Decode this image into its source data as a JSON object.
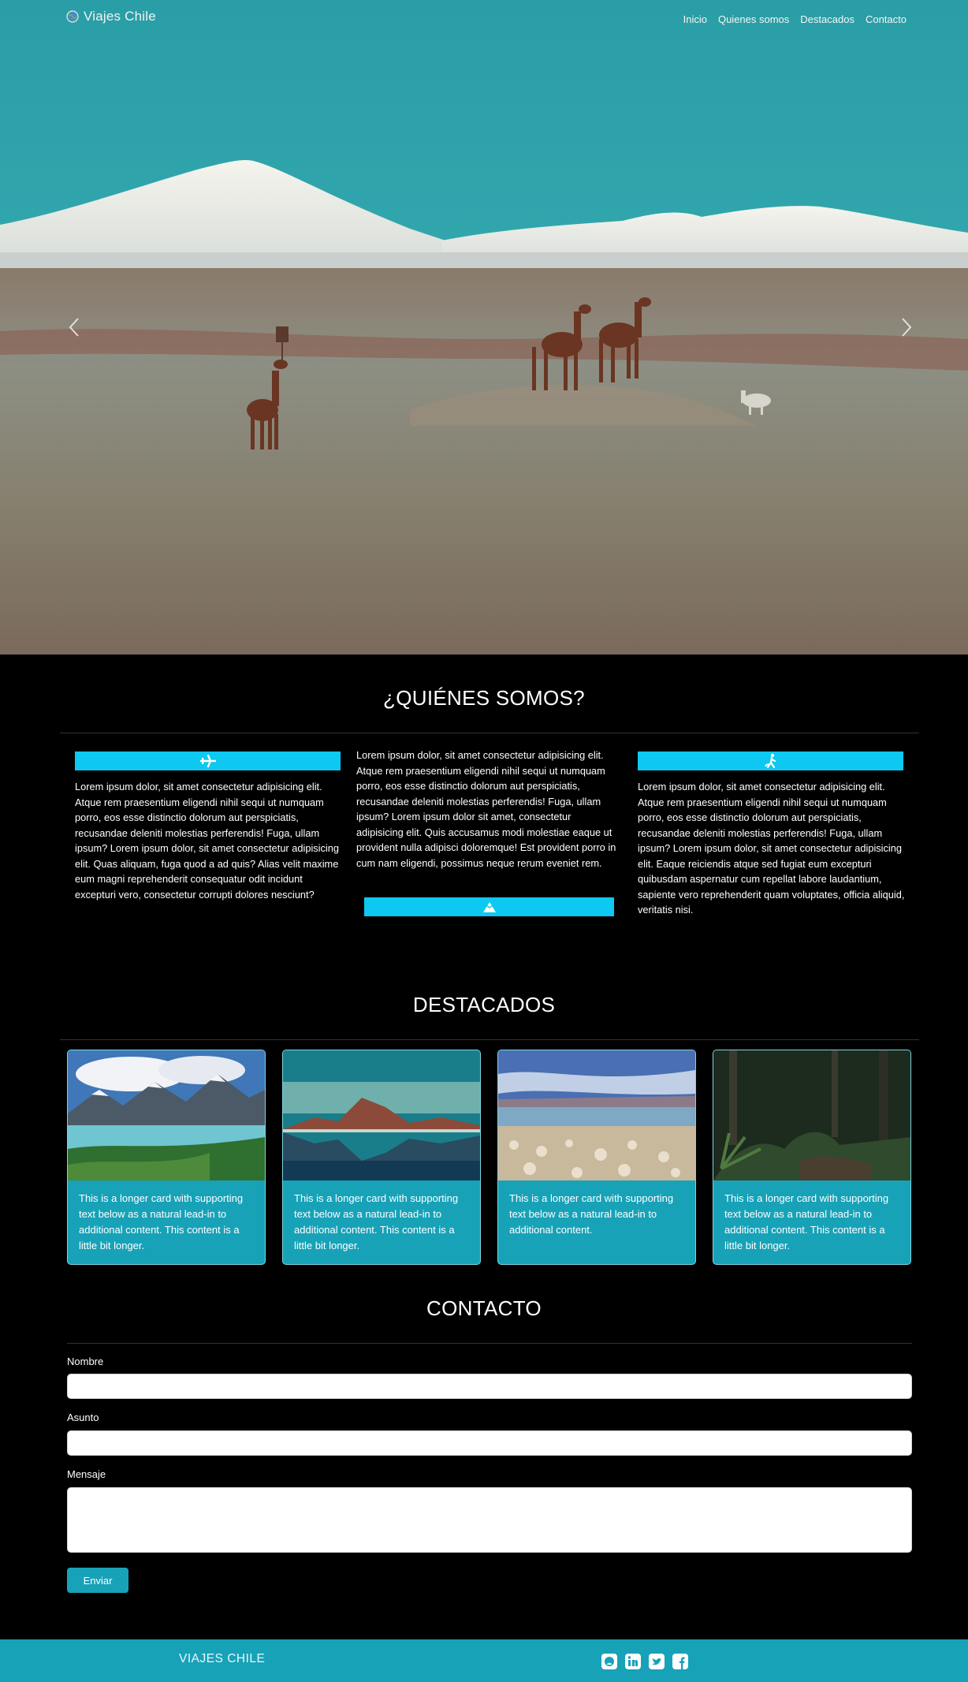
{
  "navbar": {
    "brand": "Viajes Chile",
    "links": [
      "Inicio",
      "Quienes somos",
      "Destacados",
      "Contacto"
    ]
  },
  "about": {
    "title": "¿QUIÉNES SOMOS?",
    "columns": [
      {
        "icon": "airplane-icon",
        "text": "Lorem ipsum dolor, sit amet consectetur adipisicing elit. Atque rem praesentium eligendi nihil sequi ut numquam porro, eos esse distinctio dolorum aut perspiciatis, recusandae deleniti molestias perferendis! Fuga, ullam ipsum? Lorem ipsum dolor, sit amet consectetur adipisicing elit. Quas aliquam, fuga quod a ad quis? Alias velit maxime eum magni reprehenderit consequatur odit incidunt excepturi vero, consectetur corrupti dolores nesciunt?"
      },
      {
        "icon": "mountain-icon",
        "text": "Lorem ipsum dolor, sit amet consectetur adipisicing elit. Atque rem praesentium eligendi nihil sequi ut numquam porro, eos esse distinctio dolorum aut perspiciatis, recusandae deleniti molestias perferendis! Fuga, ullam ipsum? Lorem ipsum dolor sit amet, consectetur adipisicing elit. Quis accusamus modi molestiae eaque ut provident nulla adipisci doloremque! Est provident porro in cum nam eligendi, possimus neque rerum eveniet rem."
      },
      {
        "icon": "hiking-icon",
        "text": "Lorem ipsum dolor, sit amet consectetur adipisicing elit. Atque rem praesentium eligendi nihil sequi ut numquam porro, eos esse distinctio dolorum aut perspiciatis, recusandae deleniti molestias perferendis! Fuga, ullam ipsum? Lorem ipsum dolor, sit amet consectetur adipisicing elit. Eaque reiciendis atque sed fugiat eum excepturi quibusdam aspernatur cum repellat labore laudantium, sapiente vero reprehenderit quam voluptates, officia aliquid, veritatis nisi."
      }
    ]
  },
  "featured": {
    "title": "DESTACADOS",
    "cards": [
      {
        "text": "This is a longer card with supporting text below as a natural lead-in to additional content. This content is a little bit longer."
      },
      {
        "text": "This is a longer card with supporting text below as a natural lead-in to additional content. This content is a little bit longer."
      },
      {
        "text": "This is a longer card with supporting text below as a natural lead-in to additional content."
      },
      {
        "text": "This is a longer card with supporting text below as a natural lead-in to additional content. This content is a little bit longer."
      }
    ]
  },
  "contact": {
    "title": "CONTACTO",
    "name_label": "Nombre",
    "name_value": "",
    "subject_label": "Asunto",
    "subject_value": "",
    "message_label": "Mensaje",
    "message_value": "",
    "submit_label": "Enviar"
  },
  "footer": {
    "brand": "VIAJES CHILE",
    "social_icons": [
      "github-icon",
      "linkedin-icon",
      "twitter-icon",
      "facebook-icon"
    ]
  },
  "colors": {
    "accent": "#17a2b8",
    "icon_bar": "#0dc8f0",
    "background": "#000000"
  }
}
